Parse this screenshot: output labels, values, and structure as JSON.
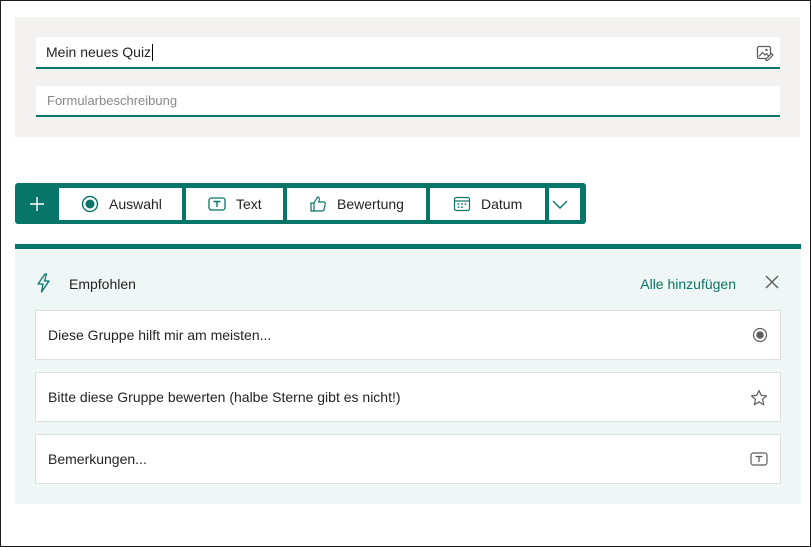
{
  "form": {
    "title": "Mein neues Quiz",
    "description_placeholder": "Formularbeschreibung"
  },
  "toolbar": {
    "add_icon": "plus-icon",
    "buttons": [
      {
        "label": "Auswahl",
        "icon": "radio-icon"
      },
      {
        "label": "Text",
        "icon": "text-icon"
      },
      {
        "label": "Bewertung",
        "icon": "thumbs-up-icon"
      },
      {
        "label": "Datum",
        "icon": "calendar-icon"
      }
    ],
    "more_icon": "chevron-down-icon"
  },
  "recommended": {
    "title": "Empfohlen",
    "add_all": "Alle hinzufügen",
    "items": [
      {
        "label": "Diese Gruppe hilft mir am meisten...",
        "icon": "radio-icon"
      },
      {
        "label": "Bitte diese Gruppe bewerten (halbe Sterne gibt es nicht!)",
        "icon": "star-icon"
      },
      {
        "label": "Bemerkungen...",
        "icon": "text-icon"
      }
    ]
  },
  "colors": {
    "accent": "#077568",
    "panel_bg": "#eff6f6",
    "header_bg": "#f3f2f1"
  }
}
